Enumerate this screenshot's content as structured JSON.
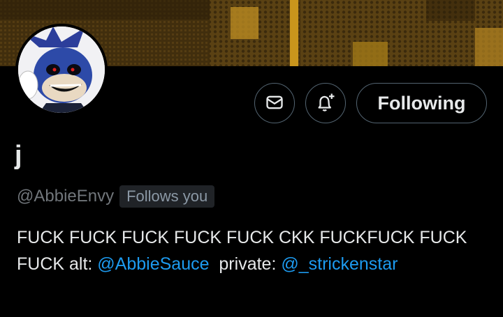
{
  "profile": {
    "display_name": "j",
    "handle": "@AbbieEnvy",
    "follows_you_badge": "Follows you",
    "bio": {
      "text_1": "FUCK FUCK FUCK FUCK FUCK CKK FUCKFUCK FUCK FUCK alt: ",
      "mention_1": "@AbbieSauce",
      "text_2": "  private: ",
      "mention_2": "@_strickenstar"
    }
  },
  "actions": {
    "message_icon": "envelope-icon",
    "notify_icon": "bell-plus-icon",
    "following_label": "Following"
  },
  "colors": {
    "background": "#000000",
    "text_primary": "#e7e9ea",
    "text_secondary": "#71767b",
    "link": "#1d9bf0",
    "button_border": "#536471",
    "badge_bg": "#202327"
  }
}
